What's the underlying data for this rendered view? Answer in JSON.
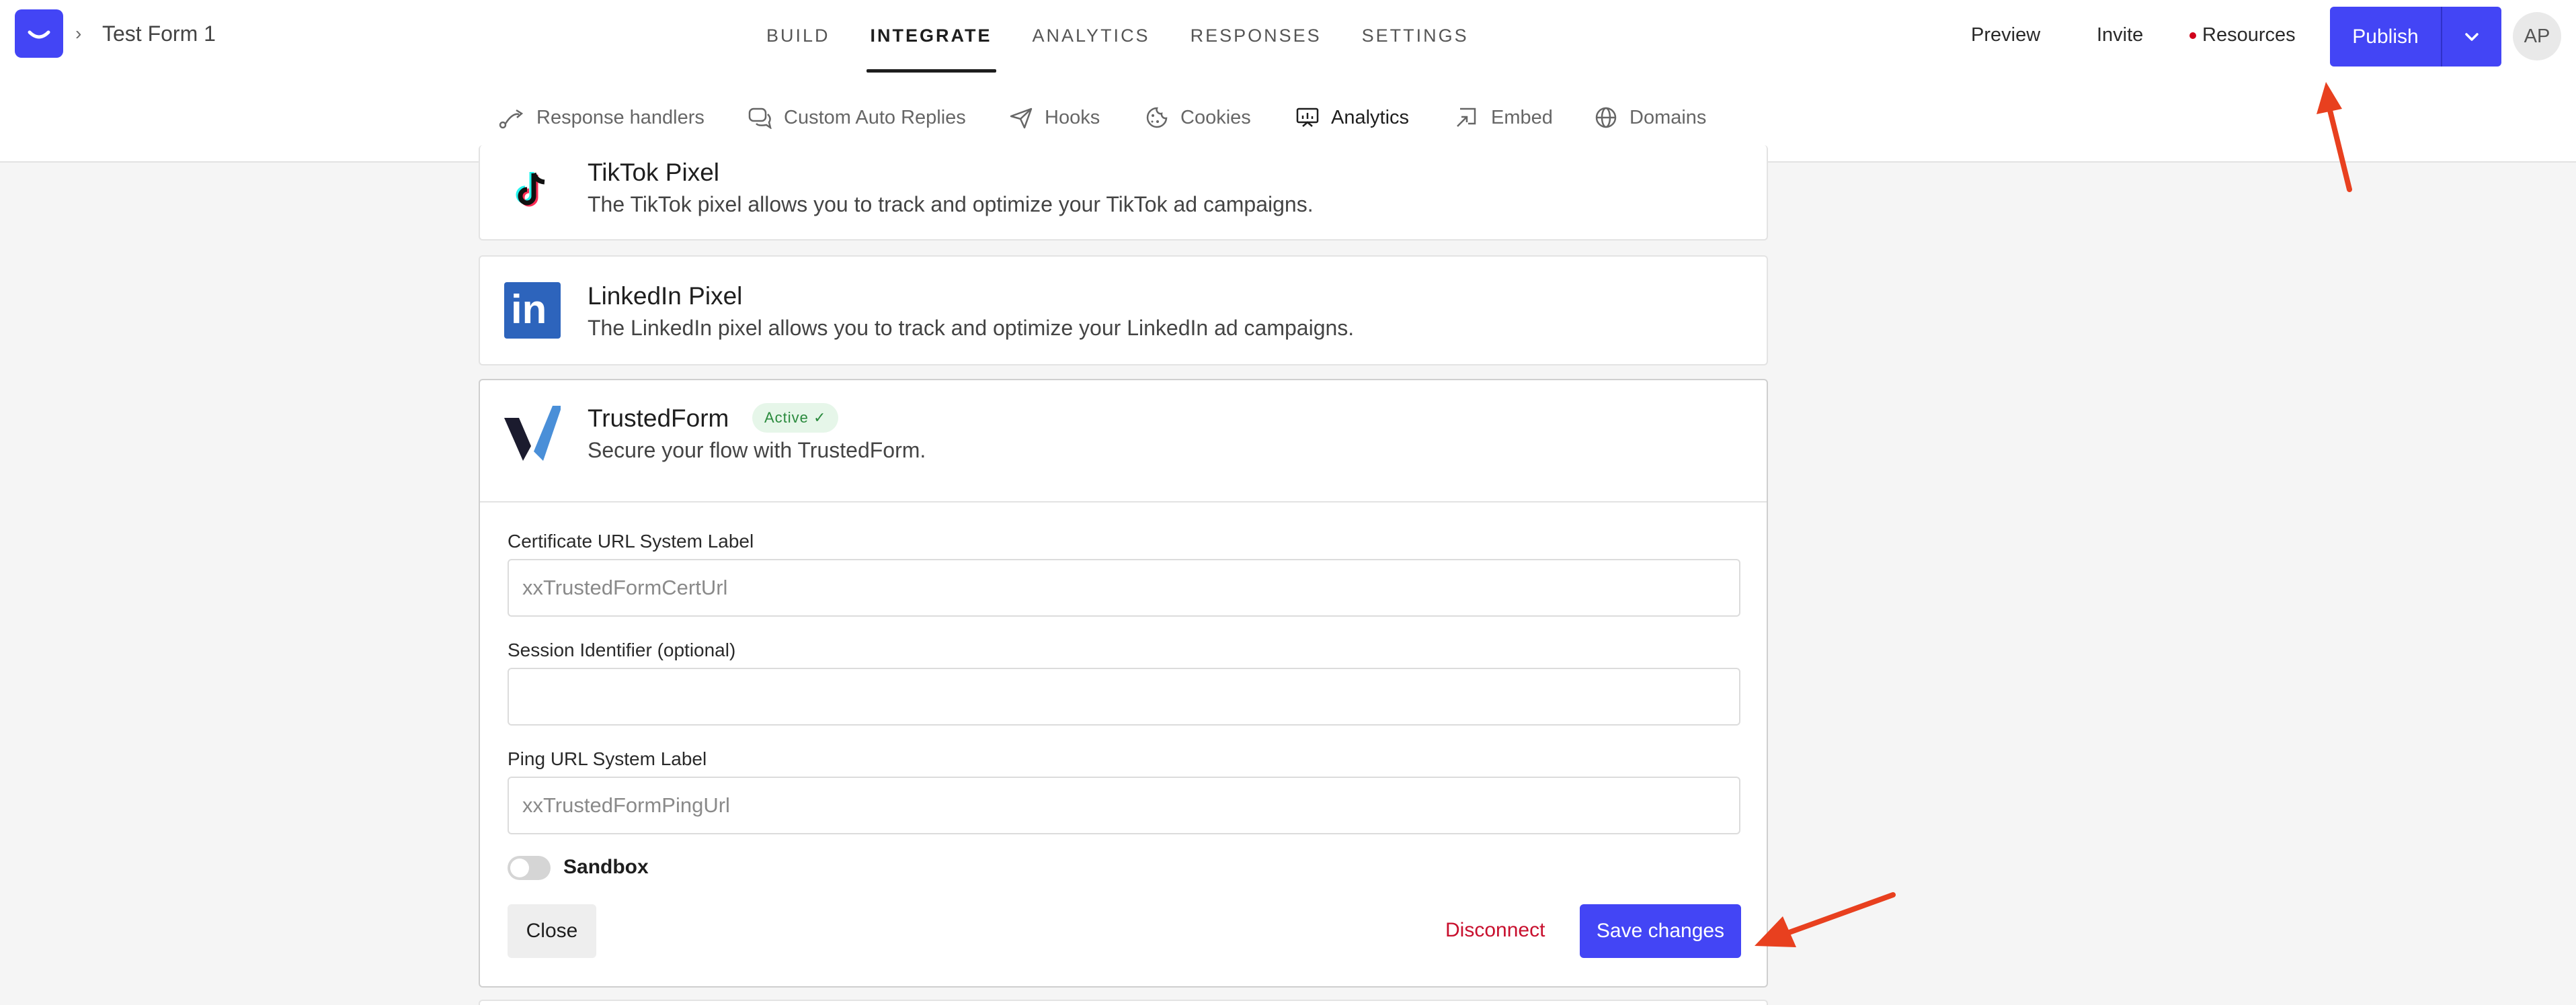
{
  "header": {
    "form_title": "Test Form 1",
    "breadcrumb_separator": "›",
    "tabs": [
      {
        "label": "BUILD",
        "active": false
      },
      {
        "label": "INTEGRATE",
        "active": true
      },
      {
        "label": "ANALYTICS",
        "active": false
      },
      {
        "label": "RESPONSES",
        "active": false
      },
      {
        "label": "SETTINGS",
        "active": false
      }
    ],
    "preview_label": "Preview",
    "invite_label": "Invite",
    "resources_label": "Resources",
    "publish_label": "Publish",
    "avatar_initials": "AP",
    "accent_color": "#4345f5"
  },
  "subnav": {
    "tabs": [
      {
        "label": "Response handlers",
        "icon": "route-icon",
        "active": false
      },
      {
        "label": "Custom Auto Replies",
        "icon": "chat-icon",
        "active": false
      },
      {
        "label": "Hooks",
        "icon": "paper-plane-icon",
        "active": false
      },
      {
        "label": "Cookies",
        "icon": "cookie-icon",
        "active": false
      },
      {
        "label": "Analytics",
        "icon": "presentation-chart-icon",
        "active": true
      },
      {
        "label": "Embed",
        "icon": "embed-icon",
        "active": false
      },
      {
        "label": "Domains",
        "icon": "globe-icon",
        "active": false
      }
    ]
  },
  "integrations": {
    "tiktok": {
      "title": "TikTok Pixel",
      "description": "The TikTok pixel allows you to track and optimize your TikTok ad campaigns."
    },
    "linkedin": {
      "title": "LinkedIn Pixel",
      "description": "The LinkedIn pixel allows you to track and optimize your LinkedIn ad campaigns.",
      "icon_text": "in"
    },
    "trustedform": {
      "title": "TrustedForm",
      "badge": "Active ✓",
      "description": "Secure your flow with TrustedForm.",
      "fields": [
        {
          "label": "Certificate URL System Label",
          "value": "",
          "placeholder": "xxTrustedFormCertUrl"
        },
        {
          "label": "Session Identifier (optional)",
          "value": "",
          "placeholder": ""
        },
        {
          "label": "Ping URL System Label",
          "value": "",
          "placeholder": "xxTrustedFormPingUrl"
        }
      ],
      "sandbox_label": "Sandbox",
      "sandbox_on": false,
      "close_label": "Close",
      "disconnect_label": "Disconnect",
      "save_label": "Save changes",
      "danger_color": "#c8102e"
    }
  },
  "annotations": {
    "arrow_color": "#e8401f"
  }
}
